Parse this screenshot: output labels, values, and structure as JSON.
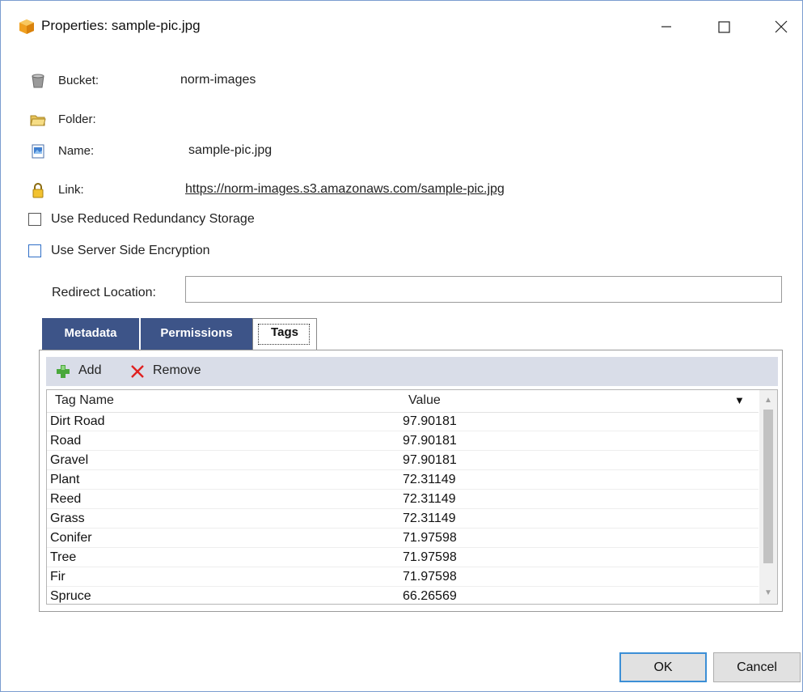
{
  "window": {
    "title": "Properties: sample-pic.jpg",
    "controls": {
      "minimize": "—",
      "maximize": "☐",
      "close": "✕"
    }
  },
  "properties": {
    "bucket": {
      "label": "Bucket:",
      "value": "norm-images",
      "icon": "bucket-icon"
    },
    "folder": {
      "label": "Folder:",
      "value": "",
      "icon": "folder-icon"
    },
    "name": {
      "label": "Name:",
      "value": "sample-pic.jpg",
      "icon": "image-file-icon"
    },
    "link": {
      "label": "Link:",
      "value": "https://norm-images.s3.amazonaws.com/sample-pic.jpg",
      "icon": "lock-icon"
    }
  },
  "options": {
    "reduced_redundancy": {
      "label": "Use Reduced Redundancy Storage",
      "checked": false
    },
    "server_side_encryption": {
      "label": "Use Server Side Encryption",
      "checked": false
    }
  },
  "redirect": {
    "label": "Redirect Location:",
    "value": ""
  },
  "tabs": [
    {
      "label": "Metadata",
      "active": false
    },
    {
      "label": "Permissions",
      "active": false
    },
    {
      "label": "Tags",
      "active": true
    }
  ],
  "toolbar": {
    "add_label": "Add",
    "remove_label": "Remove"
  },
  "tags_table": {
    "columns": [
      "Tag Name",
      "Value"
    ],
    "sort_indicator": "▼",
    "rows": [
      {
        "name": "Dirt Road",
        "value": "97.90181"
      },
      {
        "name": "Road",
        "value": "97.90181"
      },
      {
        "name": "Gravel",
        "value": "97.90181"
      },
      {
        "name": "Plant",
        "value": "72.31149"
      },
      {
        "name": "Reed",
        "value": "72.31149"
      },
      {
        "name": "Grass",
        "value": "72.31149"
      },
      {
        "name": "Conifer",
        "value": "71.97598"
      },
      {
        "name": "Tree",
        "value": "71.97598"
      },
      {
        "name": "Fir",
        "value": "71.97598"
      },
      {
        "name": "Spruce",
        "value": "66.26569"
      }
    ]
  },
  "footer": {
    "ok_label": "OK",
    "cancel_label": "Cancel"
  },
  "colors": {
    "tab_inactive": "#3d5488",
    "toolbar_bg": "#d9dde8",
    "link": "#1a5fb4",
    "ok_border": "#3c8fd6"
  }
}
